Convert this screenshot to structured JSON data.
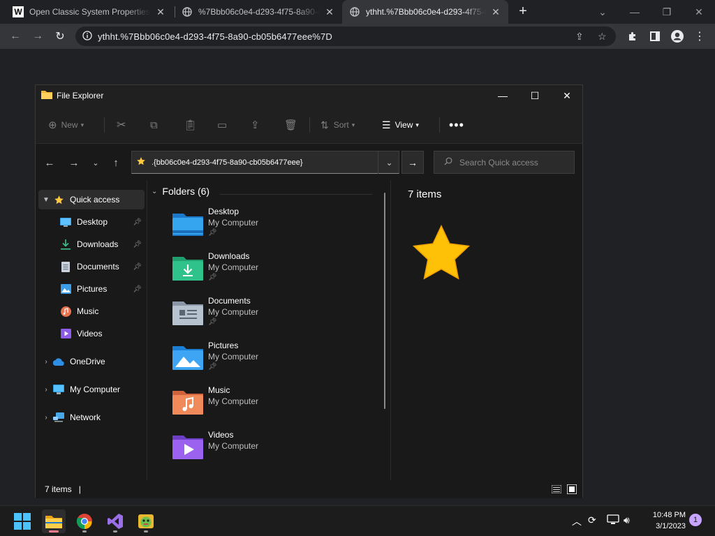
{
  "browser": {
    "tabs": [
      {
        "title": "Open Classic System Properties i",
        "favicon": "W",
        "active": false
      },
      {
        "title": "%7Bbb06c0e4-d293-4f75-8a90-c",
        "favicon": "globe-icon",
        "active": false
      },
      {
        "title": "ythht.%7Bbb06c0e4-d293-4f75-8",
        "favicon": "globe-icon",
        "active": true
      }
    ],
    "url": "ythht.%7Bbb06c0e4-d293-4f75-8a90-cb05b6477eee%7D"
  },
  "explorer": {
    "title": "File Explorer",
    "commands": {
      "new": "New",
      "sort": "Sort",
      "view": "View"
    },
    "address_path": ".{bb06c0e4-d293-4f75-8a90-cb05b6477eee}",
    "search_placeholder": "Search Quick access",
    "nav": [
      {
        "label": "Quick access",
        "icon": "star-icon"
      },
      {
        "label": "Desktop",
        "icon": "desktop-icon",
        "pinned": true
      },
      {
        "label": "Downloads",
        "icon": "downloads-icon",
        "pinned": true
      },
      {
        "label": "Documents",
        "icon": "documents-icon",
        "pinned": true
      },
      {
        "label": "Pictures",
        "icon": "pictures-icon",
        "pinned": true
      },
      {
        "label": "Music",
        "icon": "music-icon"
      },
      {
        "label": "Videos",
        "icon": "videos-icon"
      },
      {
        "label": "OneDrive",
        "icon": "cloud-icon"
      },
      {
        "label": "My Computer",
        "icon": "computer-icon"
      },
      {
        "label": "Network",
        "icon": "network-icon"
      }
    ],
    "group_header": "Folders (6)",
    "folders": [
      {
        "name": "Desktop",
        "location": "My Computer",
        "pinned": true
      },
      {
        "name": "Downloads",
        "location": "My Computer",
        "pinned": true
      },
      {
        "name": "Documents",
        "location": "My Computer",
        "pinned": true
      },
      {
        "name": "Pictures",
        "location": "My Computer",
        "pinned": true
      },
      {
        "name": "Music",
        "location": "My Computer",
        "pinned": false
      },
      {
        "name": "Videos",
        "location": "My Computer",
        "pinned": false
      }
    ],
    "details_count": "7 items",
    "status_count": "7 items"
  },
  "taskbar": {
    "time": "10:48 PM",
    "date": "3/1/2023",
    "notifications": "1"
  }
}
